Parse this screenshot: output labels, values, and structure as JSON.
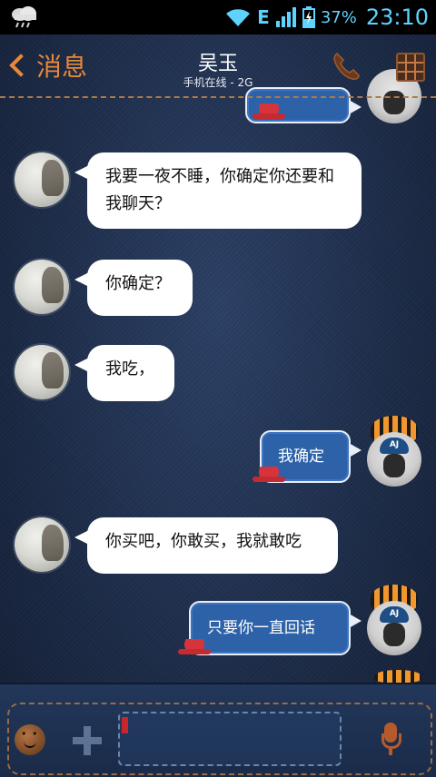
{
  "status_bar": {
    "network_type": "E",
    "battery_percent": "37%",
    "time": "23:10"
  },
  "header": {
    "back_label": "消息",
    "contact_name": "吴玉",
    "contact_status": "手机在线 - 2G"
  },
  "messages": [
    {
      "side": "left",
      "text": "我要一夜不睡，你确定你还要和我聊天？"
    },
    {
      "side": "left",
      "text": "你确定？"
    },
    {
      "side": "left",
      "text": "我吃，"
    },
    {
      "side": "right",
      "text": "我确定"
    },
    {
      "side": "left",
      "text": "你买吧，你敢买，我就敢吃"
    },
    {
      "side": "right",
      "text": "只要你一直回话"
    }
  ],
  "input": {
    "text_value": ""
  },
  "icons": {
    "weather": "cloud-rain-icon",
    "wifi": "wifi-icon",
    "signal": "signal-bars-icon",
    "battery": "battery-charging-icon",
    "back": "chevron-left-icon",
    "call": "phone-icon",
    "menu": "grid-menu-icon",
    "emoji": "smiley-icon",
    "attach": "plus-icon",
    "voice": "microphone-icon"
  },
  "colors": {
    "accent": "#e8893a",
    "status_text": "#5fd3ff",
    "right_bubble": "#2e62a8",
    "left_bubble": "#ffffff"
  }
}
